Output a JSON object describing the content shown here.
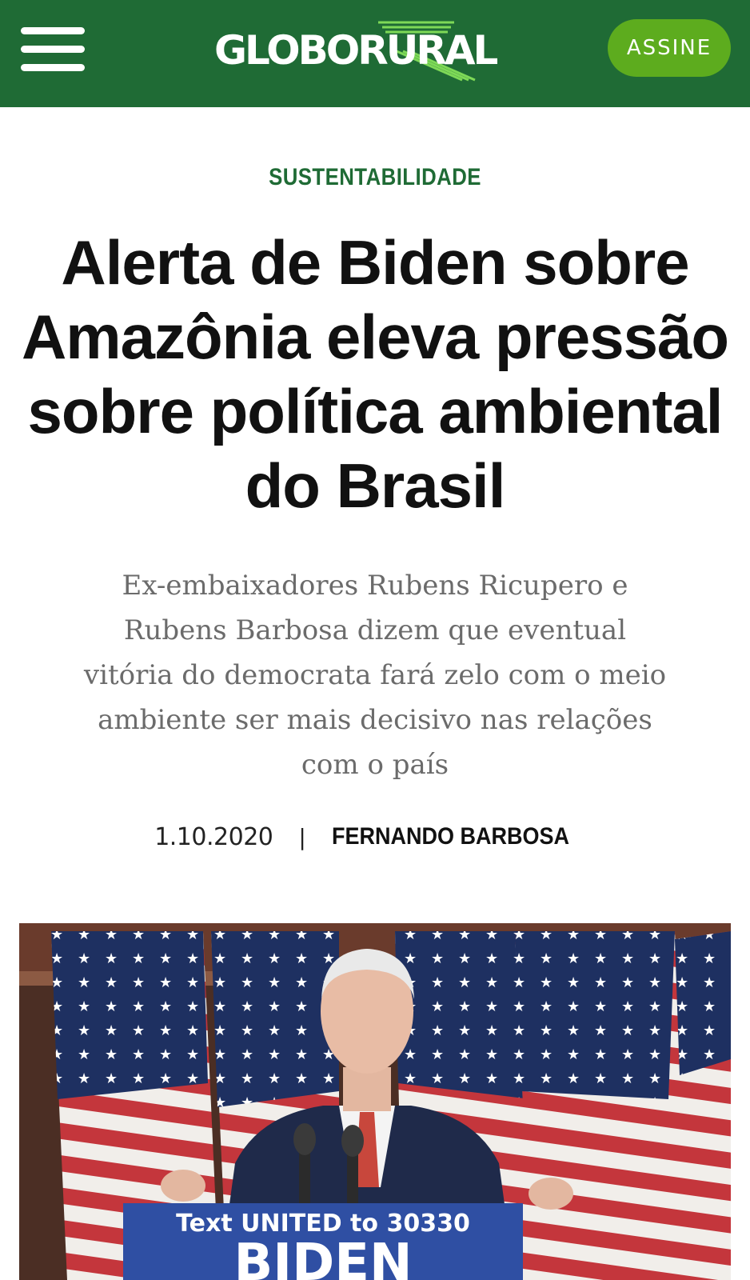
{
  "header": {
    "logo_text": "GLOBORURAL",
    "subscribe_label": "ASSINE",
    "brand_color": "#1f6b35",
    "button_color": "#5dac1e",
    "menu_icon": "hamburger-menu-icon"
  },
  "article": {
    "section": "SUSTENTABILIDADE",
    "headline_lines": [
      "Alerta de Biden sobre",
      "Amazônia eleva pressão",
      "sobre política ambiental",
      "do Brasil"
    ],
    "summary_lines": [
      "Ex-embaixadores Rubens Ricupero e",
      "Rubens Barbosa dizem que eventual",
      "vitória do democrata fará zelo com o meio",
      "ambiente ser mais decisivo nas relações",
      "com o país"
    ],
    "date": "1.10.2020",
    "separator": "|",
    "author": "FERNANDO BARBOSA",
    "photo": {
      "podium_text": "Text UNITED to 30330",
      "podium_name": "BIDEN"
    }
  }
}
